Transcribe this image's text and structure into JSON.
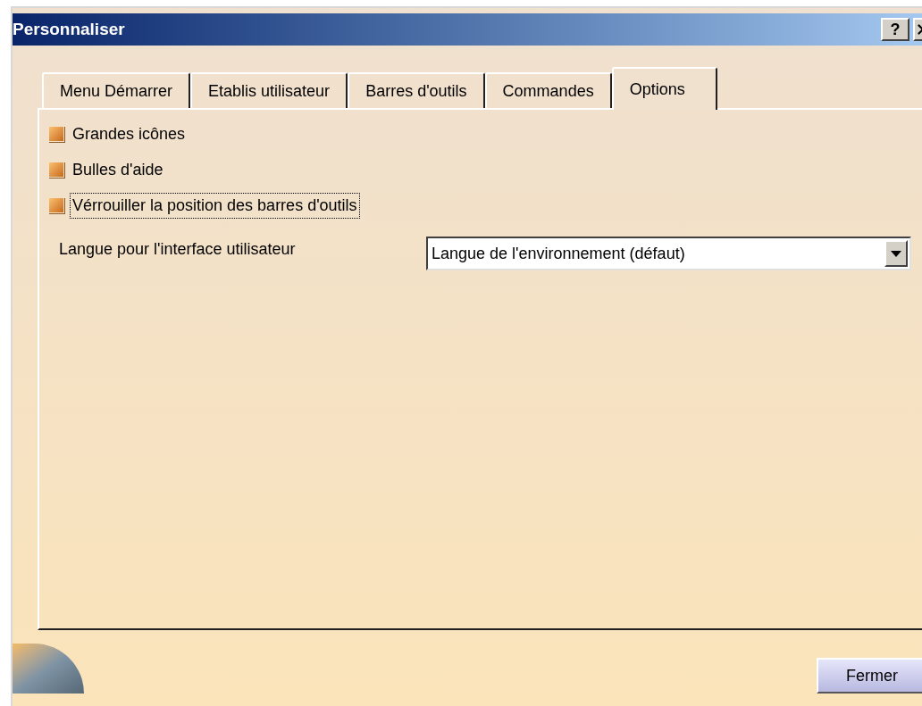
{
  "window": {
    "title": "Personnaliser",
    "help": "?"
  },
  "tabs": [
    {
      "label": "Menu Démarrer",
      "selected": false
    },
    {
      "label": "Etablis utilisateur",
      "selected": false
    },
    {
      "label": "Barres d'outils",
      "selected": false
    },
    {
      "label": "Commandes",
      "selected": false
    },
    {
      "label": "Options",
      "selected": true
    }
  ],
  "options": [
    {
      "label": "Grandes icônes",
      "checked": true,
      "focused": false
    },
    {
      "label": "Bulles d'aide",
      "checked": true,
      "focused": false
    },
    {
      "label": "Vérrouiller la position des barres d'outils",
      "checked": true,
      "focused": true
    }
  ],
  "language": {
    "label": "Langue pour l'interface utilisateur",
    "value": "Langue de l'environnement (défaut)"
  },
  "buttons": [
    "Fermer"
  ]
}
